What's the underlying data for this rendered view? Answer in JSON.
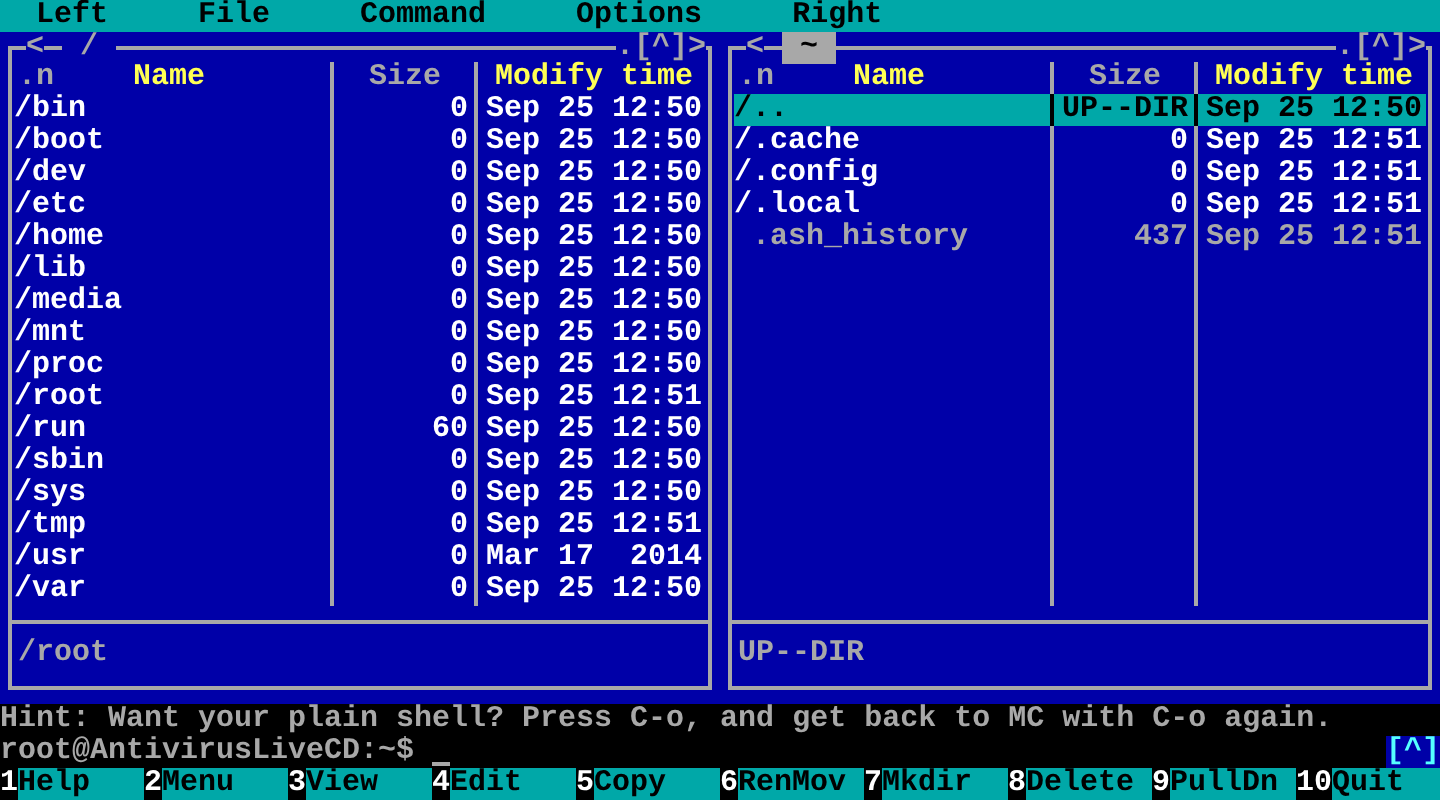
{
  "menu": [
    "Left",
    "File",
    "Command",
    "Options",
    "Right"
  ],
  "panels": [
    {
      "nav_prev": "<",
      "path": "/",
      "active": false,
      "nav_next": ".[^]>",
      "sort_mark": ".n",
      "columns": [
        {
          "label": "Name",
          "highlighted": true
        },
        {
          "label": "Size",
          "highlighted": false
        },
        {
          "label": "Modify time",
          "highlighted": true
        }
      ],
      "rows": [
        {
          "name": "/bin",
          "size": "0",
          "time": "Sep 25 12:50",
          "kind": "dir",
          "selected": false
        },
        {
          "name": "/boot",
          "size": "0",
          "time": "Sep 25 12:50",
          "kind": "dir",
          "selected": false
        },
        {
          "name": "/dev",
          "size": "0",
          "time": "Sep 25 12:50",
          "kind": "dir",
          "selected": false
        },
        {
          "name": "/etc",
          "size": "0",
          "time": "Sep 25 12:50",
          "kind": "dir",
          "selected": false
        },
        {
          "name": "/home",
          "size": "0",
          "time": "Sep 25 12:50",
          "kind": "dir",
          "selected": false
        },
        {
          "name": "/lib",
          "size": "0",
          "time": "Sep 25 12:50",
          "kind": "dir",
          "selected": false
        },
        {
          "name": "/media",
          "size": "0",
          "time": "Sep 25 12:50",
          "kind": "dir",
          "selected": false
        },
        {
          "name": "/mnt",
          "size": "0",
          "time": "Sep 25 12:50",
          "kind": "dir",
          "selected": false
        },
        {
          "name": "/proc",
          "size": "0",
          "time": "Sep 25 12:50",
          "kind": "dir",
          "selected": false
        },
        {
          "name": "/root",
          "size": "0",
          "time": "Sep 25 12:51",
          "kind": "dir",
          "selected": false
        },
        {
          "name": "/run",
          "size": "60",
          "time": "Sep 25 12:50",
          "kind": "dir",
          "selected": false
        },
        {
          "name": "/sbin",
          "size": "0",
          "time": "Sep 25 12:50",
          "kind": "dir",
          "selected": false
        },
        {
          "name": "/sys",
          "size": "0",
          "time": "Sep 25 12:50",
          "kind": "dir",
          "selected": false
        },
        {
          "name": "/tmp",
          "size": "0",
          "time": "Sep 25 12:51",
          "kind": "dir",
          "selected": false
        },
        {
          "name": "/usr",
          "size": "0",
          "time": "Mar 17  2014",
          "kind": "dir",
          "selected": false
        },
        {
          "name": "/var",
          "size": "0",
          "time": "Sep 25 12:50",
          "kind": "dir",
          "selected": false
        }
      ],
      "status": "/root"
    },
    {
      "nav_prev": "<",
      "path": "~",
      "active": true,
      "nav_next": ".[^]>",
      "sort_mark": ".n",
      "columns": [
        {
          "label": "Name",
          "highlighted": true
        },
        {
          "label": "Size",
          "highlighted": false
        },
        {
          "label": "Modify time",
          "highlighted": true
        }
      ],
      "rows": [
        {
          "name": "/..",
          "size": "UP--DIR",
          "time": "Sep 25 12:50",
          "kind": "dir",
          "selected": true
        },
        {
          "name": "/.cache",
          "size": "0",
          "time": "Sep 25 12:51",
          "kind": "dir",
          "selected": false
        },
        {
          "name": "/.config",
          "size": "0",
          "time": "Sep 25 12:51",
          "kind": "dir",
          "selected": false
        },
        {
          "name": "/.local",
          "size": "0",
          "time": "Sep 25 12:51",
          "kind": "dir",
          "selected": false
        },
        {
          "name": " .ash_history",
          "size": "437",
          "time": "Sep 25 12:51",
          "kind": "file",
          "selected": false
        }
      ],
      "status": "UP--DIR"
    }
  ],
  "hint": "Hint: Want your plain shell? Press C-o, and get back to MC with C-o again.",
  "prompt": "root@AntivirusLiveCD:~$",
  "history_button": "[^]",
  "function_keys": [
    {
      "number": "1",
      "label": "Help"
    },
    {
      "number": "2",
      "label": "Menu"
    },
    {
      "number": "3",
      "label": "View"
    },
    {
      "number": "4",
      "label": "Edit"
    },
    {
      "number": "5",
      "label": "Copy"
    },
    {
      "number": "6",
      "label": "RenMov"
    },
    {
      "number": "7",
      "label": "Mkdir"
    },
    {
      "number": "8",
      "label": "Delete"
    },
    {
      "number": "9",
      "label": "PullDn"
    },
    {
      "number": "10",
      "label": "Quit"
    }
  ]
}
